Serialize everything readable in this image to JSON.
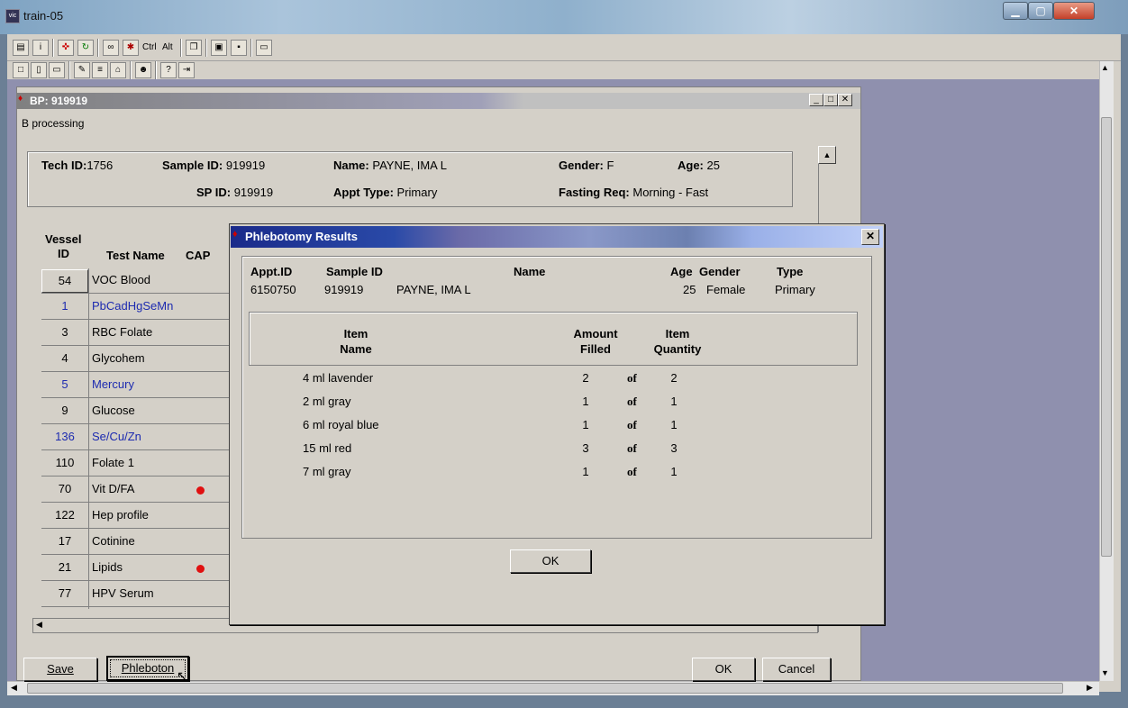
{
  "window": {
    "title": "train-05"
  },
  "toolbar": {
    "ctrl_label": "Ctrl",
    "alt_label": "Alt"
  },
  "bp": {
    "title": "BP: 919919",
    "subtitle": "B processing",
    "tech_id_label": "Tech ID:",
    "tech_id": "1756",
    "sample_id_label": "Sample ID:",
    "sample_id": "919919",
    "name_label": "Name:",
    "name": "PAYNE, IMA L",
    "gender_label": "Gender:",
    "gender": "F",
    "age_label": "Age:",
    "age": "25",
    "sp_id_label": "SP ID:",
    "sp_id": "919919",
    "appt_type_label": "Appt Type:",
    "appt_type": "Primary",
    "fasting_label": "Fasting Req:",
    "fasting": "Morning - Fast",
    "col_vessel": "Vessel",
    "col_id": "ID",
    "col_test": "Test Name",
    "col_cap": "CAP",
    "rows": [
      {
        "id": "54",
        "test": "VOC Blood",
        "blue": false,
        "cap": false
      },
      {
        "id": "1",
        "test": "PbCadHgSeMn",
        "blue": true,
        "cap": false
      },
      {
        "id": "3",
        "test": "RBC Folate",
        "blue": false,
        "cap": false
      },
      {
        "id": "4",
        "test": "Glycohem",
        "blue": false,
        "cap": false
      },
      {
        "id": "5",
        "test": "Mercury",
        "blue": true,
        "cap": false
      },
      {
        "id": "9",
        "test": "Glucose",
        "blue": false,
        "cap": false
      },
      {
        "id": "136",
        "test": "Se/Cu/Zn",
        "blue": true,
        "cap": false
      },
      {
        "id": "110",
        "test": "Folate 1",
        "blue": false,
        "cap": false
      },
      {
        "id": "70",
        "test": "Vit D/FA",
        "blue": false,
        "cap": true
      },
      {
        "id": "122",
        "test": "Hep profile",
        "blue": false,
        "cap": false
      },
      {
        "id": "17",
        "test": "Cotinine",
        "blue": false,
        "cap": false
      },
      {
        "id": "21",
        "test": "Lipids",
        "blue": false,
        "cap": true
      },
      {
        "id": "77",
        "test": "HPV Serum",
        "blue": false,
        "cap": false
      }
    ],
    "save_label": "Save",
    "phlebotomy_label": "Phleboton",
    "ok_label": "OK",
    "cancel_label": "Cancel"
  },
  "dialog": {
    "title": "Phlebotomy Results",
    "hdr_appt": "Appt.ID",
    "hdr_sample": "Sample ID",
    "hdr_name": "Name",
    "hdr_age": "Age",
    "hdr_gender": "Gender",
    "hdr_type": "Type",
    "appt_id": "6150750",
    "sample_id": "919919",
    "name": "PAYNE, IMA L",
    "age": "25",
    "gender": "Female",
    "type": "Primary",
    "item_hdr_1": "Item",
    "item_hdr_2": "Name",
    "amt_hdr_1": "Amount",
    "amt_hdr_2": "Filled",
    "qty_hdr_1": "Item",
    "qty_hdr_2": "Quantity",
    "of_label": "of",
    "items": [
      {
        "name": "4 ml lavender",
        "filled": "2",
        "qty": "2"
      },
      {
        "name": "2 ml gray",
        "filled": "1",
        "qty": "1"
      },
      {
        "name": "6 ml royal blue",
        "filled": "1",
        "qty": "1"
      },
      {
        "name": "15 ml red",
        "filled": "3",
        "qty": "3"
      },
      {
        "name": "7 ml gray",
        "filled": "1",
        "qty": "1"
      }
    ],
    "ok_label": "OK"
  }
}
